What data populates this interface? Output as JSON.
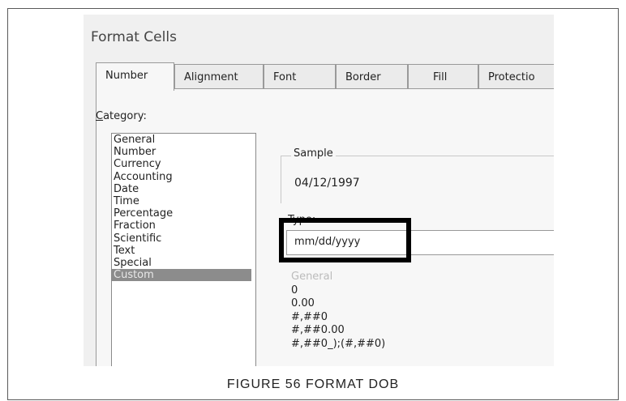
{
  "dialog": {
    "title": "Format Cells",
    "tabs": [
      "Number",
      "Alignment",
      "Font",
      "Border",
      "Fill",
      "Protectio"
    ],
    "category_label_underlined": "C",
    "category_label_rest": "ategory:",
    "categories": [
      "General",
      "Number",
      "Currency",
      "Accounting",
      "Date",
      "Time",
      "Percentage",
      "Fraction",
      "Scientific",
      "Text",
      "Special",
      "Custom"
    ],
    "selected_category": "Custom",
    "sample_label": "Sample",
    "sample_value": "04/12/1997",
    "type_label": "Type:",
    "type_value": "mm/dd/yyyy",
    "format_list": [
      "General",
      "0",
      "0.00",
      "#,##0",
      "#,##0.00",
      "#,##0_);(#,##0)"
    ]
  },
  "caption": "FIGURE 56 FORMAT DOB"
}
